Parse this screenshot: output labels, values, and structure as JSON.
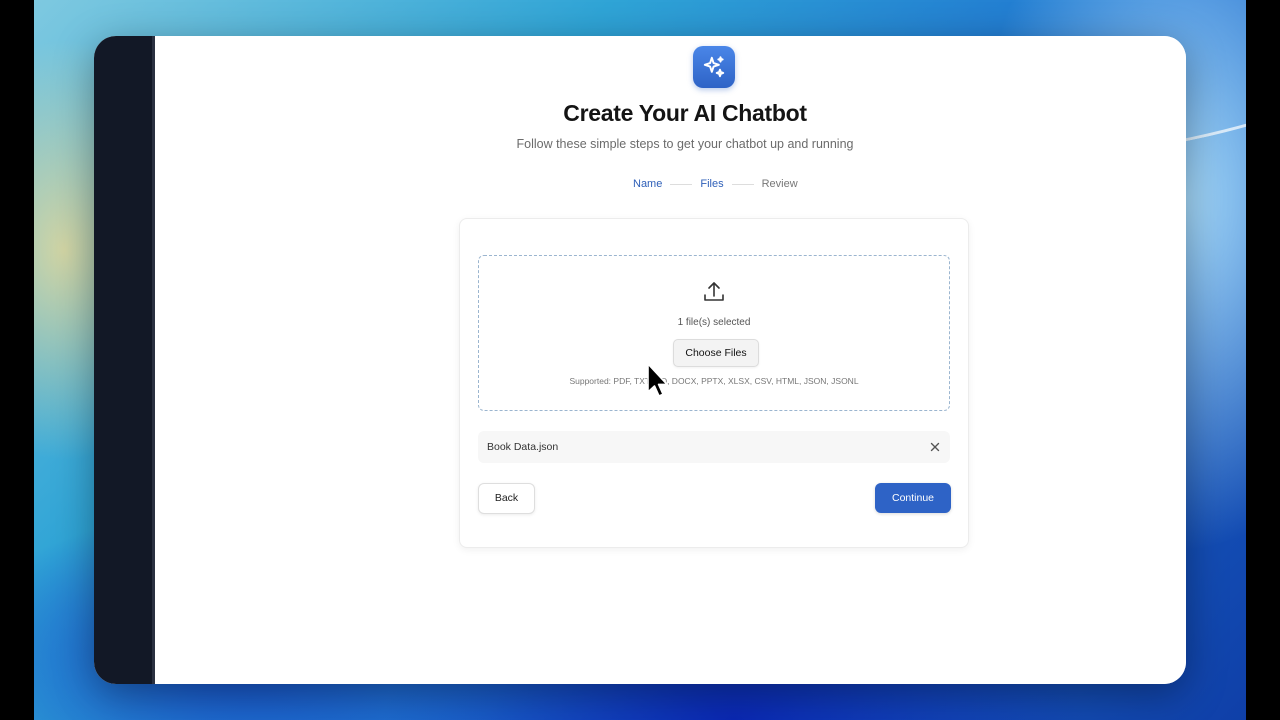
{
  "header": {
    "icon": "sparkles-icon",
    "title": "Create Your AI Chatbot",
    "subtitle": "Follow these simple steps to get your chatbot up and running"
  },
  "stepper": {
    "steps": [
      {
        "label": "Name",
        "state": "complete"
      },
      {
        "label": "Files",
        "state": "current"
      },
      {
        "label": "Review",
        "state": "upcoming"
      }
    ]
  },
  "upload": {
    "icon": "upload-icon",
    "selected_text": "1 file(s) selected",
    "choose_label": "Choose Files",
    "supported_text": "Supported: PDF, TXT, MD, DOCX, PPTX, XLSX, CSV, HTML, JSON, JSONL"
  },
  "files": [
    {
      "name": "Book Data.json",
      "remove_icon": "close-icon"
    }
  ],
  "actions": {
    "back_label": "Back",
    "continue_label": "Continue"
  },
  "colors": {
    "accent": "#2e63c6",
    "active_step": "#2e5fb8",
    "sidebar": "#121826"
  }
}
